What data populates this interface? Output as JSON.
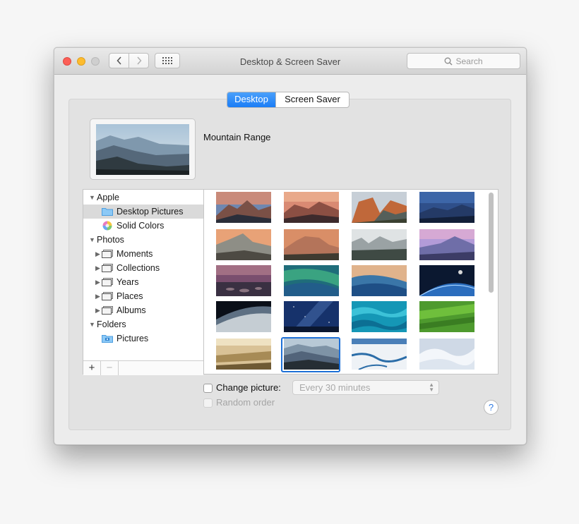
{
  "window": {
    "title": "Desktop & Screen Saver",
    "search_placeholder": "Search"
  },
  "tabs": [
    {
      "label": "Desktop",
      "selected": true
    },
    {
      "label": "Screen Saver",
      "selected": false
    }
  ],
  "preview": {
    "name": "Mountain Range"
  },
  "sidebar": {
    "groups": [
      {
        "label": "Apple",
        "expanded": true,
        "items": [
          {
            "label": "Desktop Pictures",
            "icon": "folder-icon",
            "selected": true
          },
          {
            "label": "Solid Colors",
            "icon": "color-wheel-icon",
            "selected": false
          }
        ]
      },
      {
        "label": "Photos",
        "expanded": true,
        "items": [
          {
            "label": "Moments",
            "icon": "photo-stack-icon"
          },
          {
            "label": "Collections",
            "icon": "photo-stack-icon"
          },
          {
            "label": "Years",
            "icon": "photo-stack-icon"
          },
          {
            "label": "Places",
            "icon": "photo-stack-icon"
          },
          {
            "label": "Albums",
            "icon": "photo-stack-icon"
          }
        ]
      },
      {
        "label": "Folders",
        "expanded": true,
        "items": [
          {
            "label": "Pictures",
            "icon": "camera-folder-icon"
          }
        ]
      }
    ],
    "add_label": "+",
    "remove_label": "−"
  },
  "wallpapers": [
    "sierra-peak-dusk",
    "sierra-ridge-sunset",
    "el-capitan-sunset",
    "blue-mountain-night",
    "half-dome-dusk",
    "el-capitan-wall",
    "yosemite-valley-mist",
    "half-dome-purple",
    "lake-rocks-dusk",
    "green-wave",
    "blue-wave",
    "earth-horizon-space",
    "earth-orbit",
    "galaxy-sky",
    "turquoise-water",
    "green-fields",
    "golden-forest-mist",
    "mountain-range",
    "ice-river",
    "snow-dunes"
  ],
  "selected_wallpaper_index": 17,
  "options": {
    "change_picture_label": "Change picture:",
    "change_picture_checked": false,
    "interval_value": "Every 30 minutes",
    "random_order_label": "Random order",
    "random_order_checked": false,
    "help_label": "?"
  },
  "colors": {
    "accent": "#1b7df6",
    "selection": "#dadada",
    "close": "#fc5f57",
    "minimize": "#fdbc2e"
  }
}
